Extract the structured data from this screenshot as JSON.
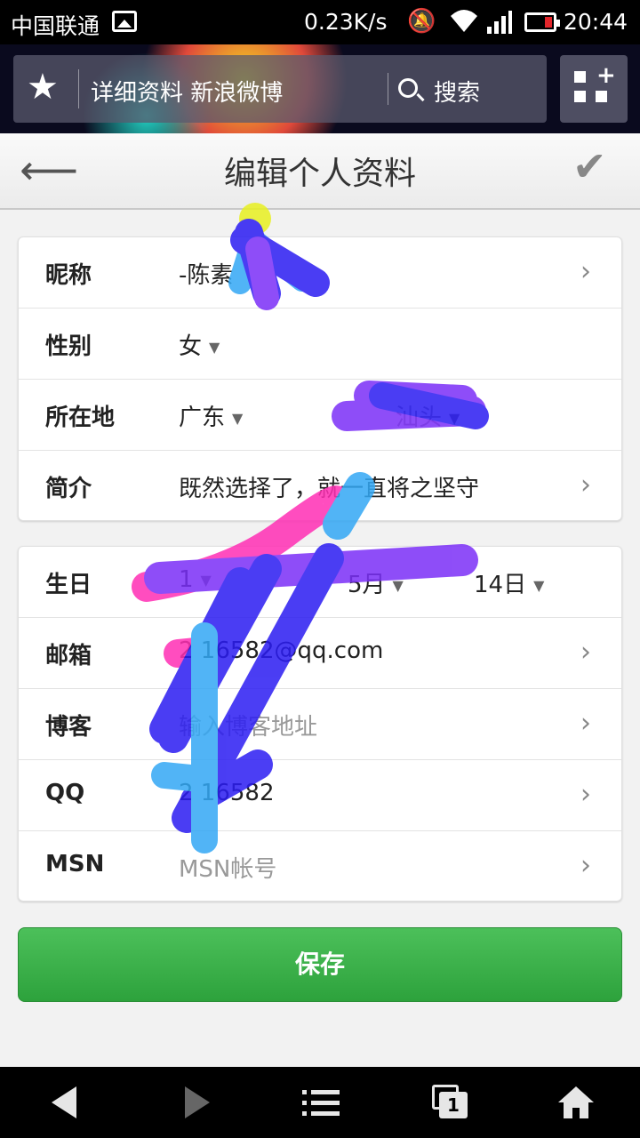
{
  "status_bar": {
    "carrier": "中国联通",
    "speed": "0.23K/s",
    "time": "20:44"
  },
  "browser": {
    "url_title": "详细资料 新浪微博",
    "search_label": "搜索"
  },
  "header": {
    "title": "编辑个人资料"
  },
  "profile": {
    "nickname_label": "昵称",
    "nickname_value": "-陈素",
    "gender_label": "性别",
    "gender_value": "女",
    "location_label": "所在地",
    "province_value": "广东",
    "city_value": "汕头",
    "bio_label": "简介",
    "bio_value": "既然选择了，就一直将之坚守"
  },
  "contact": {
    "birthday_label": "生日",
    "birthday_year": "1",
    "birthday_month": "5月",
    "birthday_day": "14日",
    "email_label": "邮箱",
    "email_value": "2  16582@qq.com",
    "blog_label": "博客",
    "blog_placeholder": "输入博客地址",
    "qq_label": "QQ",
    "qq_value": "2  16582",
    "msn_label": "MSN",
    "msn_placeholder": "MSN帐号"
  },
  "save_button": "保存",
  "colors": {
    "save_green": "#34a843",
    "scribble_blue": "#2b1cf2",
    "scribble_purple": "#7b2ff7",
    "scribble_pink": "#ff2fb4",
    "scribble_cyan": "#33a8f5"
  }
}
